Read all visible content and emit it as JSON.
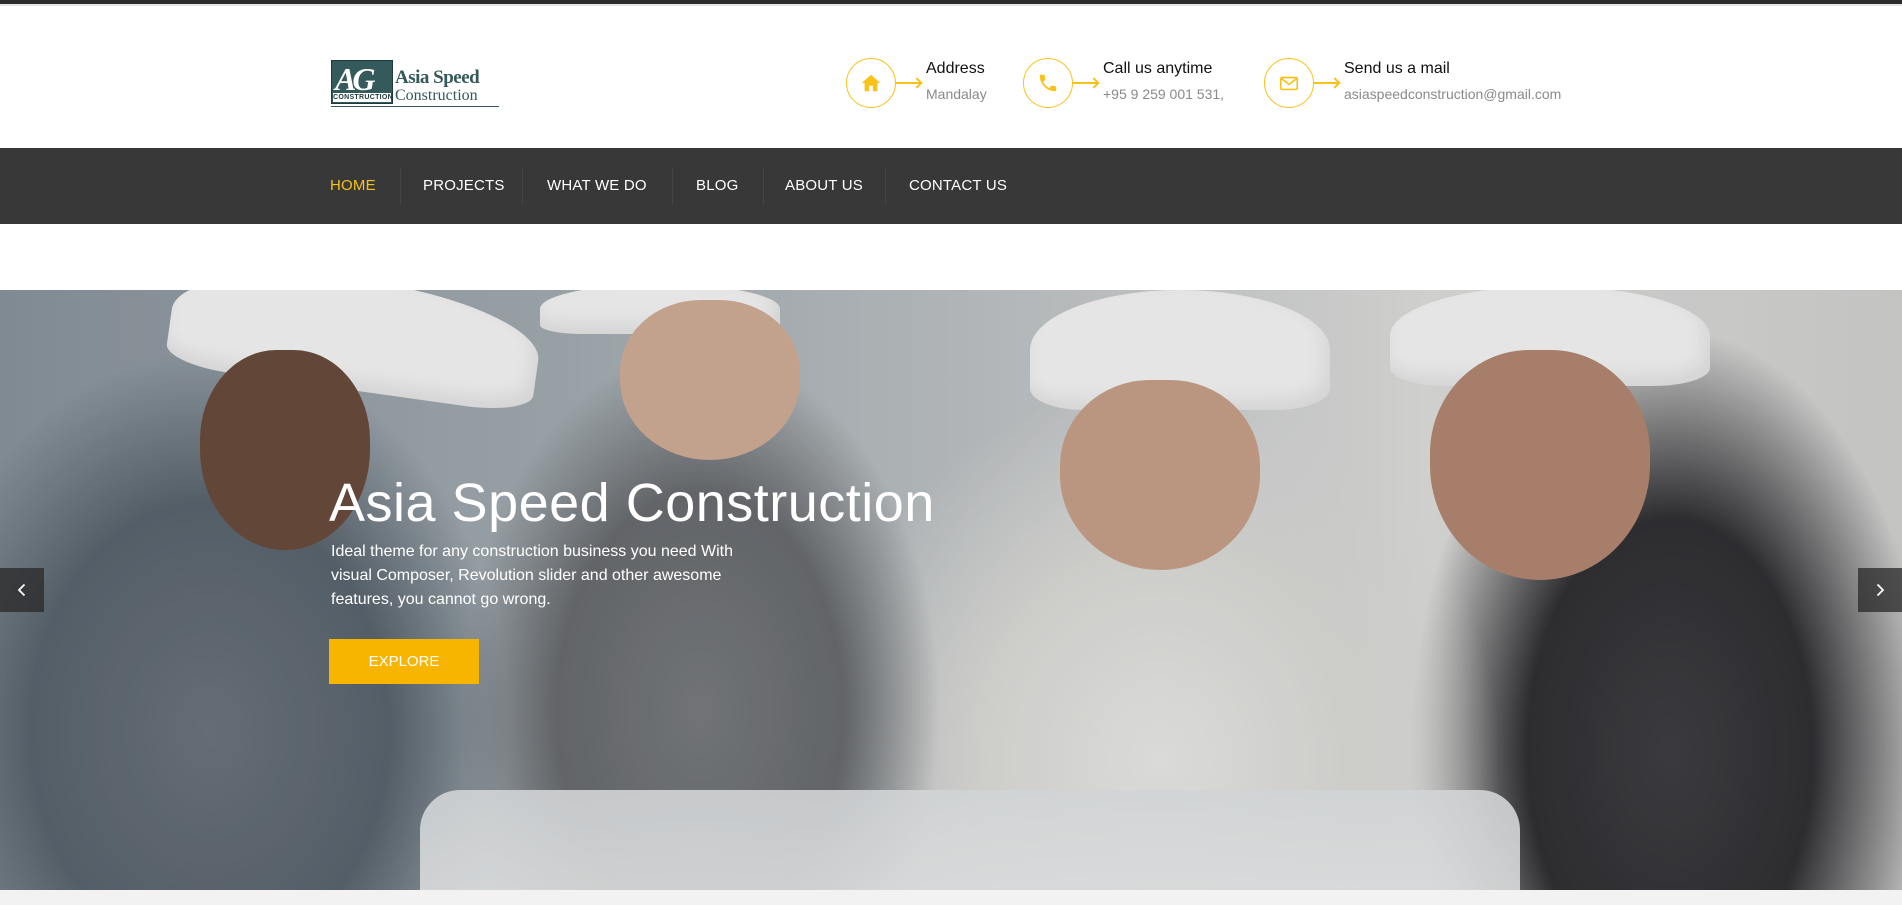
{
  "brand": {
    "logo_mark": "AG",
    "logo_sub": "CONSTRUCTION",
    "logo_line1": "Asia Speed",
    "logo_line2": "Construction"
  },
  "contacts": [
    {
      "icon": "home-icon",
      "label": "Address",
      "value": "Mandalay"
    },
    {
      "icon": "phone-icon",
      "label": "Call us anytime",
      "value": "+95 9 259 001 531,"
    },
    {
      "icon": "envelope-icon",
      "label": "Send us a mail",
      "value": "asiaspeedconstruction@gmail.com"
    }
  ],
  "nav": {
    "items": [
      {
        "label": "HOME",
        "active": true
      },
      {
        "label": "PROJECTS",
        "active": false
      },
      {
        "label": "WHAT WE DO",
        "active": false
      },
      {
        "label": "BLOG",
        "active": false
      },
      {
        "label": "ABOUT US",
        "active": false
      },
      {
        "label": "CONTACT US",
        "active": false
      }
    ]
  },
  "hero": {
    "title": "Asia Speed Construction",
    "description": "Ideal theme for any construction business you need With visual Composer, Revolution slider and other awesome features, you cannot go wrong.",
    "cta_label": "EXPLORE"
  },
  "colors": {
    "accent": "#f7c21a",
    "button": "#f7b500",
    "nav_bg": "#383838"
  }
}
